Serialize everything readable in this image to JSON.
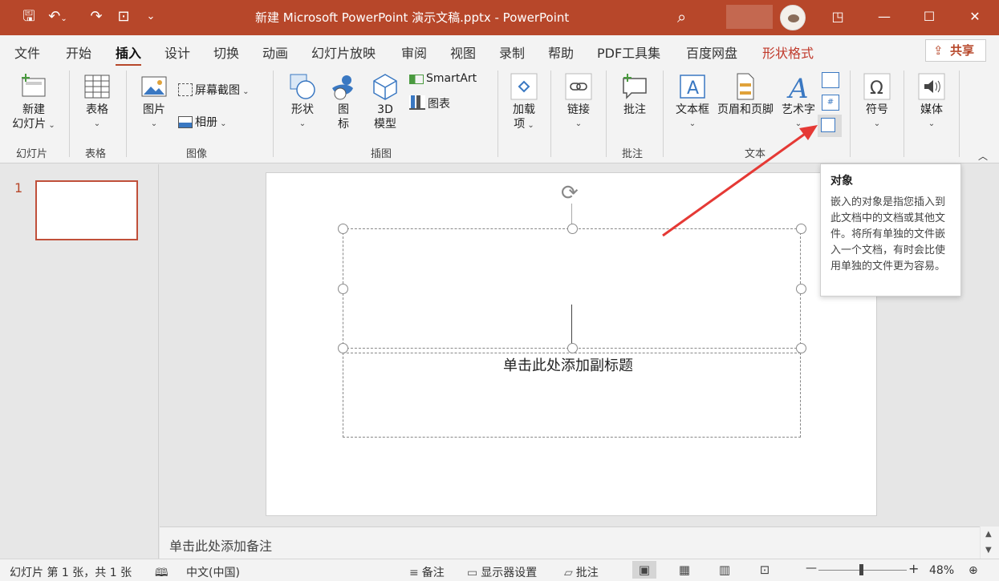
{
  "window": {
    "title": "新建 Microsoft PowerPoint 演示文稿.pptx  -  PowerPoint",
    "quick_access": [
      "save-icon",
      "undo-icon",
      "redo-icon",
      "present-from-start-icon",
      "customize-icon"
    ],
    "controls": {
      "ribbon_display": "◳",
      "minimize": "—",
      "maximize": "☐",
      "close": "✕"
    }
  },
  "tabs": [
    "文件",
    "开始",
    "插入",
    "设计",
    "切换",
    "动画",
    "幻灯片放映",
    "审阅",
    "视图",
    "录制",
    "帮助",
    "PDF工具集",
    "百度网盘",
    "形状格式"
  ],
  "active_tab": "插入",
  "share_label": "共享",
  "ribbon": {
    "groups": {
      "slides": "幻灯片",
      "tables": "表格",
      "images": "图像",
      "illustrations": "插图",
      "addins": "",
      "links": "",
      "comments": "批注",
      "text": "文本",
      "symbols": "",
      "media": ""
    },
    "buttons": {
      "new_slide_line1": "新建",
      "new_slide_line2": "幻灯片",
      "table": "表格",
      "picture": "图片",
      "screenshot": "屏幕截图",
      "album": "相册",
      "shapes": "形状",
      "icons_line1": "图",
      "icons_line2": "标",
      "model3d_line1": "3D",
      "model3d_line2": "模型",
      "smartart": "SmartArt",
      "chart": "图表",
      "addins_line1": "加载",
      "addins_line2": "项",
      "link": "链接",
      "comment": "批注",
      "textbox": "文本框",
      "header_footer": "页眉和页脚",
      "wordart": "艺术字",
      "symbol": "符号",
      "media": "媒体"
    }
  },
  "tooltip": {
    "title": "对象",
    "body": "嵌入的对象是指您插入到此文档中的文档或其他文件。将所有单独的文件嵌入一个文档，有时会比使用单独的文件更为容易。"
  },
  "thumbnail": {
    "number": "1"
  },
  "slide": {
    "subtitle_placeholder": "单击此处添加副标题"
  },
  "notes_placeholder": "单击此处添加备注",
  "status": {
    "slide_info": "幻灯片 第 1 张，共 1 张",
    "language": "中文(中国)",
    "notes": "备注",
    "display_settings": "显示器设置",
    "comments": "批注",
    "zoom": "48%",
    "zoom_minus": "—",
    "zoom_plus": "+"
  }
}
